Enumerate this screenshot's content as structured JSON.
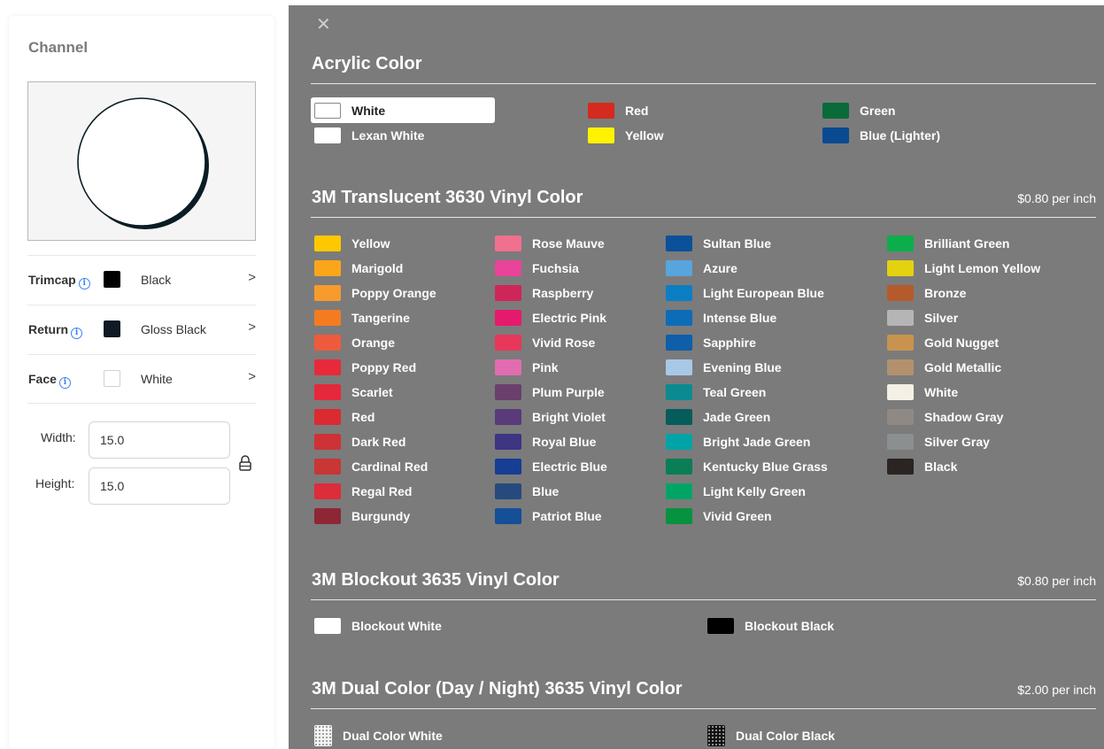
{
  "left": {
    "title": "Channel",
    "options": [
      {
        "label": "Trimcap",
        "value": "Black",
        "swatch": "#000000"
      },
      {
        "label": "Return",
        "value": "Gloss Black",
        "swatch": "#0e1a24"
      },
      {
        "label": "Face",
        "value": "White",
        "swatch": "#ffffff"
      }
    ],
    "width_label": "Width",
    "width_value": "15.0",
    "height_label": "Height",
    "height_value": "15.0"
  },
  "modal": {
    "close_icon": "close-icon",
    "sections": [
      {
        "title": "Acrylic Color",
        "price": "",
        "columns": [
          [
            {
              "name": "White",
              "color": "#ffffff",
              "selected": true
            },
            {
              "name": "Lexan White",
              "color": "#ffffff"
            }
          ],
          [
            {
              "name": "Red",
              "color": "#d42a1f"
            },
            {
              "name": "Yellow",
              "color": "#fff200"
            }
          ],
          [
            {
              "name": "Green",
              "color": "#0a6b3a"
            },
            {
              "name": "Blue (Lighter)",
              "color": "#0a4a91"
            }
          ]
        ]
      },
      {
        "title": "3M Translucent 3630 Vinyl Color",
        "price": "$0.80 per inch",
        "columns": [
          [
            {
              "name": "Yellow",
              "color": "#fec800"
            },
            {
              "name": "Marigold",
              "color": "#fba61a"
            },
            {
              "name": "Poppy Orange",
              "color": "#f69b2c"
            },
            {
              "name": "Tangerine",
              "color": "#f47b20"
            },
            {
              "name": "Orange",
              "color": "#ef5a3c"
            },
            {
              "name": "Poppy Red",
              "color": "#e8293a"
            },
            {
              "name": "Scarlet",
              "color": "#e6283b"
            },
            {
              "name": "Red",
              "color": "#dc2a31"
            },
            {
              "name": "Dark Red",
              "color": "#cd3236"
            },
            {
              "name": "Cardinal Red",
              "color": "#c83636"
            },
            {
              "name": "Regal Red",
              "color": "#dd2c3a"
            },
            {
              "name": "Burgundy",
              "color": "#8d2735"
            }
          ],
          [
            {
              "name": "Rose Mauve",
              "color": "#f0708f"
            },
            {
              "name": "Fuchsia",
              "color": "#e9449a"
            },
            {
              "name": "Raspberry",
              "color": "#cf2659"
            },
            {
              "name": "Electric Pink",
              "color": "#e61a6d"
            },
            {
              "name": "Vivid Rose",
              "color": "#e8385a"
            },
            {
              "name": "Pink",
              "color": "#e26cb0"
            },
            {
              "name": "Plum Purple",
              "color": "#6a3f6c"
            },
            {
              "name": "Bright Violet",
              "color": "#5a3a78"
            },
            {
              "name": "Royal Blue",
              "color": "#3e3583"
            },
            {
              "name": "Electric Blue",
              "color": "#153e94"
            },
            {
              "name": "Blue",
              "color": "#264a7e"
            },
            {
              "name": "Patriot Blue",
              "color": "#154f98"
            }
          ],
          [
            {
              "name": "Sultan Blue",
              "color": "#0a519a"
            },
            {
              "name": "Azure",
              "color": "#58a4dd"
            },
            {
              "name": "Light European Blue",
              "color": "#0c7ec4"
            },
            {
              "name": "Intense Blue",
              "color": "#0d6cb8"
            },
            {
              "name": "Sapphire",
              "color": "#0e5ea9"
            },
            {
              "name": "Evening Blue",
              "color": "#a8c8e8"
            },
            {
              "name": "Teal Green",
              "color": "#0b8a91"
            },
            {
              "name": "Jade Green",
              "color": "#065c5a"
            },
            {
              "name": "Bright Jade Green",
              "color": "#00a4a6"
            },
            {
              "name": "Kentucky Blue Grass",
              "color": "#0a7e55"
            },
            {
              "name": "Light Kelly Green",
              "color": "#00a566"
            },
            {
              "name": "Vivid Green",
              "color": "#07923f"
            }
          ],
          [
            {
              "name": "Brilliant Green",
              "color": "#0bae4a"
            },
            {
              "name": "Light Lemon Yellow",
              "color": "#e3d20f"
            },
            {
              "name": "Bronze",
              "color": "#b55a2a"
            },
            {
              "name": "Silver",
              "color": "#b5b5b5"
            },
            {
              "name": "Gold Nugget",
              "color": "#c8934e"
            },
            {
              "name": "Gold Metallic",
              "color": "#b3916d"
            },
            {
              "name": "White",
              "color": "#f4f0e6"
            },
            {
              "name": "Shadow Gray",
              "color": "#8f8985"
            },
            {
              "name": "Silver Gray",
              "color": "#8a8f90"
            },
            {
              "name": "Black",
              "color": "#2a2522"
            }
          ]
        ]
      },
      {
        "title": "3M Blockout 3635 Vinyl Color",
        "price": "$0.80 per inch",
        "columns": [
          [
            {
              "name": "Blockout White",
              "color": "#ffffff"
            }
          ],
          [
            {
              "name": "Blockout Black",
              "color": "#000000"
            }
          ]
        ]
      },
      {
        "title": "3M Dual Color (Day / Night) 3635 Vinyl Color",
        "price": "$2.00 per inch",
        "columns": [
          [
            {
              "name": "Dual Color White",
              "color": "pattern-white"
            }
          ],
          [
            {
              "name": "Dual Color Black",
              "color": "pattern-black"
            }
          ]
        ]
      }
    ]
  }
}
